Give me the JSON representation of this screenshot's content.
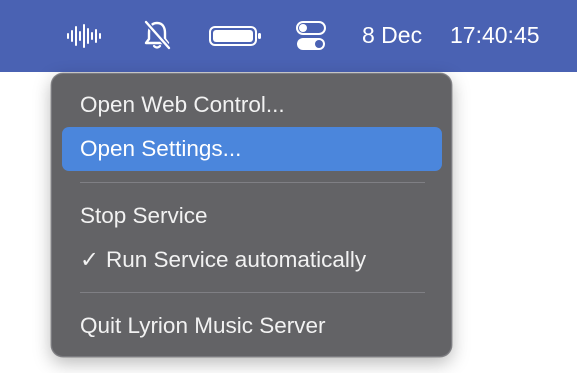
{
  "menubar": {
    "icons": [
      "waveform-icon",
      "mute-icon",
      "battery-icon",
      "control-center-icon"
    ],
    "date": "8 Dec",
    "time": "17:40:45"
  },
  "menu": {
    "items": [
      {
        "label": "Open Web Control..."
      },
      {
        "label": "Open Settings...",
        "highlighted": true
      },
      {
        "label": "Stop Service"
      },
      {
        "label": "Run Service automatically",
        "checked": true,
        "check": "✓"
      },
      {
        "label": "Quit Lyrion Music Server"
      }
    ]
  },
  "colors": {
    "menubar": "#4a62b3",
    "menu_background": "#636366",
    "highlight": "#4b86dc"
  }
}
